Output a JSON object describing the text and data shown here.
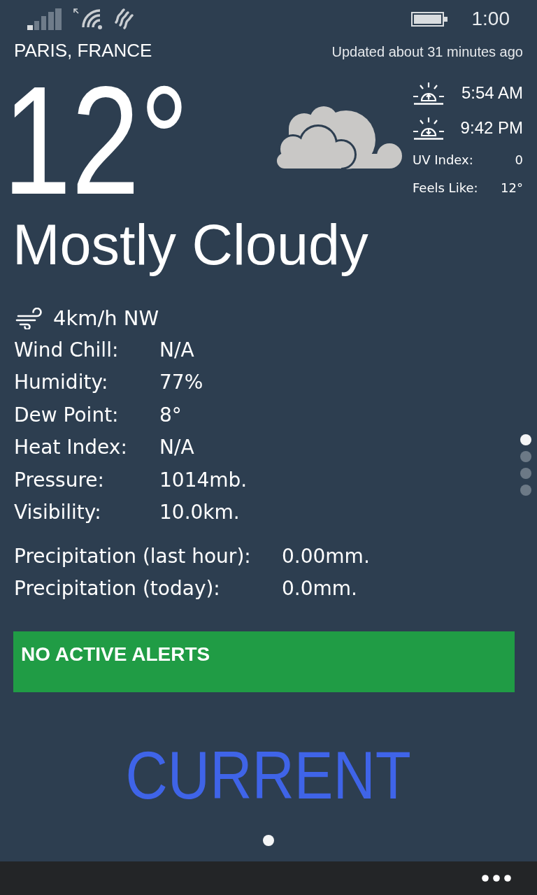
{
  "status_bar": {
    "time": "1:00"
  },
  "header": {
    "location": "PARIS, FRANCE",
    "updated": "Updated about 31 minutes ago"
  },
  "current": {
    "temperature": "12°",
    "condition": "Mostly Cloudy"
  },
  "sun_times": [
    {
      "kind": "sunrise",
      "time": "5:54 AM"
    },
    {
      "kind": "sunset",
      "time": "9:42 PM"
    }
  ],
  "side_stats": [
    {
      "label": "UV Index:",
      "value": "0"
    },
    {
      "label": "Feels Like:",
      "value": "12°"
    }
  ],
  "wind": {
    "value": "4km/h NW"
  },
  "details": [
    {
      "label": "Wind Chill:",
      "value": "N/A"
    },
    {
      "label": "Humidity:",
      "value": "77%"
    },
    {
      "label": "Dew Point:",
      "value": "8°"
    },
    {
      "label": "Heat Index:",
      "value": "N/A"
    },
    {
      "label": "Pressure:",
      "value": "1014mb."
    },
    {
      "label": "Visibility:",
      "value": "10.0km."
    }
  ],
  "precipitation": [
    {
      "label": "Precipitation (last hour):",
      "value": "0.00mm."
    },
    {
      "label": "Precipitation (today):",
      "value": "0.0mm."
    }
  ],
  "alert": {
    "text": "NO ACTIVE ALERTS"
  },
  "section_dots": [
    {
      "selected": true
    },
    {
      "selected": false
    },
    {
      "selected": false
    },
    {
      "selected": false
    }
  ],
  "pivot": {
    "title": "CURRENT",
    "dots": [
      {
        "selected": true
      }
    ]
  }
}
